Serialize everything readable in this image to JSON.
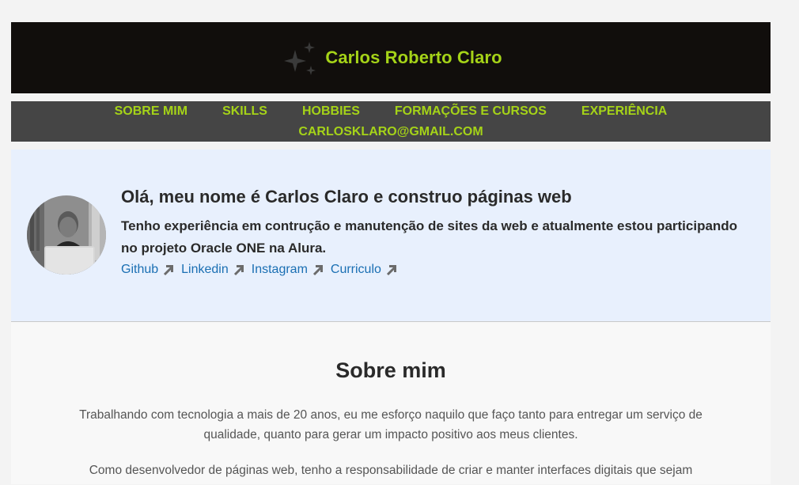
{
  "header": {
    "title": "Carlos Roberto Claro",
    "colors": {
      "background": "#110e0c",
      "accent": "#a5d318"
    }
  },
  "nav": {
    "items": [
      {
        "label": "SOBRE MIM"
      },
      {
        "label": "SKILLS"
      },
      {
        "label": "HOBBIES"
      },
      {
        "label": "FORMAÇÕES E CURSOS"
      },
      {
        "label": "EXPERIÊNCIA"
      },
      {
        "label": "CARLOSKLARO@GMAIL.COM"
      }
    ]
  },
  "hero": {
    "title": "Olá, meu nome é Carlos Claro e construo páginas web",
    "description": "Tenho experiência em contrução e manutenção de sites da web e atualmente estou participando no projeto Oracle ONE na Alura.",
    "links": [
      {
        "label": "Github",
        "icon": "arrow-up-right-icon"
      },
      {
        "label": "Linkedin",
        "icon": "arrow-up-right-icon"
      },
      {
        "label": "Instagram",
        "icon": "arrow-up-right-icon"
      },
      {
        "label": "Curriculo",
        "icon": "arrow-up-right-icon"
      }
    ],
    "colors": {
      "background": "#e8f0fd",
      "link": "#1a6fb3"
    }
  },
  "about": {
    "title": "Sobre mim",
    "paragraphs": [
      "Trabalhando com tecnologia a mais de 20 anos, eu me esforço naquilo que faço tanto para entregar um serviço de qualidade, quanto para gerar um impacto positivo aos meus clientes.",
      "Como desenvolvedor de páginas web, tenho a responsabilidade de criar e manter interfaces digitais que sejam"
    ]
  }
}
